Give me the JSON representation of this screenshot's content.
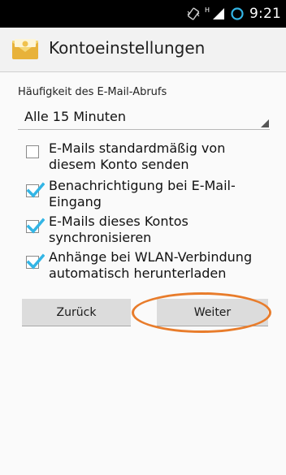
{
  "status_bar": {
    "time": "9:21",
    "signal_label": "H",
    "icons": [
      "vibrate-icon",
      "signal-icon",
      "sync-icon"
    ]
  },
  "action_bar": {
    "title": "Kontoeinstellungen",
    "icon": "email-envelope-icon"
  },
  "settings": {
    "frequency_label": "Häufigkeit des E-Mail-Abrufs",
    "frequency_value": "Alle 15 Minuten",
    "options": [
      {
        "label_line1": "E-Mails standardmäßig von",
        "label_line2": "diesem Konto senden",
        "checked": false
      },
      {
        "label_line1": "Benachrichtigung bei E-Mail-",
        "label_line2": "Eingang",
        "checked": true
      },
      {
        "label_line1": "E-Mails dieses Kontos",
        "label_line2": "synchronisieren",
        "checked": true
      },
      {
        "label_line1": "Anhänge bei WLAN-Verbindung",
        "label_line2": "automatisch herunterladen",
        "checked": true
      }
    ]
  },
  "buttons": {
    "back_label": "Zurück",
    "next_label": "Weiter"
  },
  "colors": {
    "accent": "#33b5e5",
    "highlight_ring": "#e87c2b",
    "status_bar": "#000000"
  }
}
